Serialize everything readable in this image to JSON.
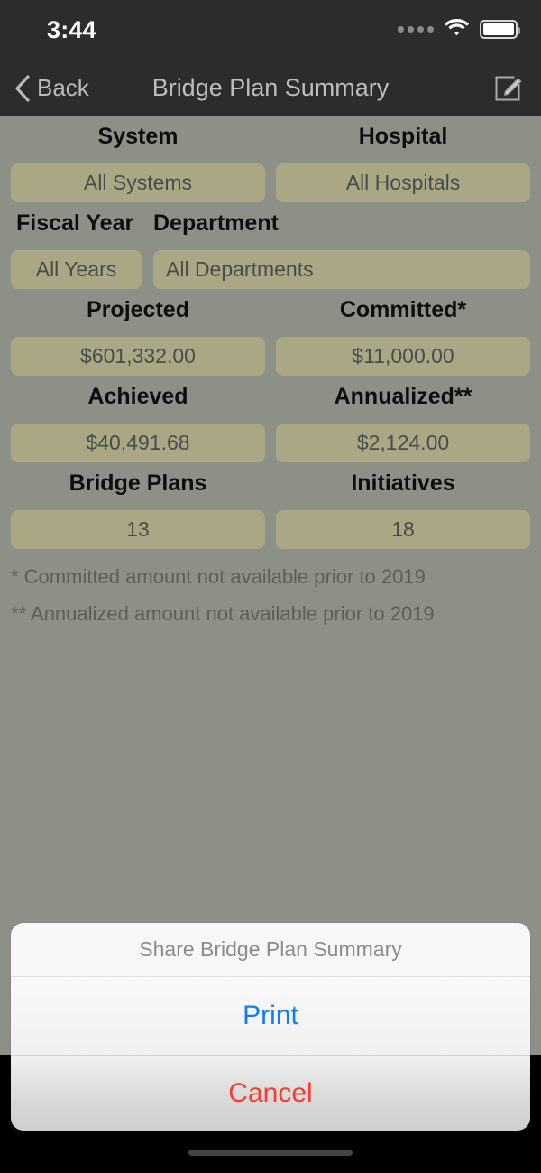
{
  "status_bar": {
    "time": "3:44",
    "signal_icon": "signal-dots-icon",
    "wifi_icon": "wifi-icon",
    "battery_icon": "battery-full-icon"
  },
  "nav_bar": {
    "back_label": "Back",
    "back_icon": "chevron-left-icon",
    "title": "Bridge Plan Summary",
    "compose_icon": "compose-icon"
  },
  "form": {
    "rows": [
      {
        "left": {
          "label": "System",
          "value": "All Systems"
        },
        "right": {
          "label": "Hospital",
          "value": "All Hospitals"
        }
      },
      {
        "left": {
          "label": "Fiscal Year",
          "value": "All Years"
        },
        "right": {
          "label": "Department",
          "value": "All Departments"
        }
      },
      {
        "left": {
          "label": "Projected",
          "value": "$601,332.00"
        },
        "right": {
          "label": "Committed*",
          "value": "$11,000.00"
        }
      },
      {
        "left": {
          "label": "Achieved",
          "value": "$40,491.68"
        },
        "right": {
          "label": "Annualized**",
          "value": "$2,124.00"
        }
      },
      {
        "left": {
          "label": "Bridge Plans",
          "value": "13"
        },
        "right": {
          "label": "Initiatives",
          "value": "18"
        }
      }
    ],
    "footnotes": [
      "* Committed amount not available prior to 2019",
      "** Annualized amount not available prior to 2019"
    ]
  },
  "action_sheet": {
    "title": "Share Bridge Plan Summary",
    "print_label": "Print",
    "cancel_label": "Cancel"
  },
  "colors": {
    "page_background": "#8d9086",
    "field_background": "#aaa784",
    "nav_background": "#2c2c2c",
    "print_accent": "#127cf7",
    "cancel_accent": "#fb3b30"
  }
}
